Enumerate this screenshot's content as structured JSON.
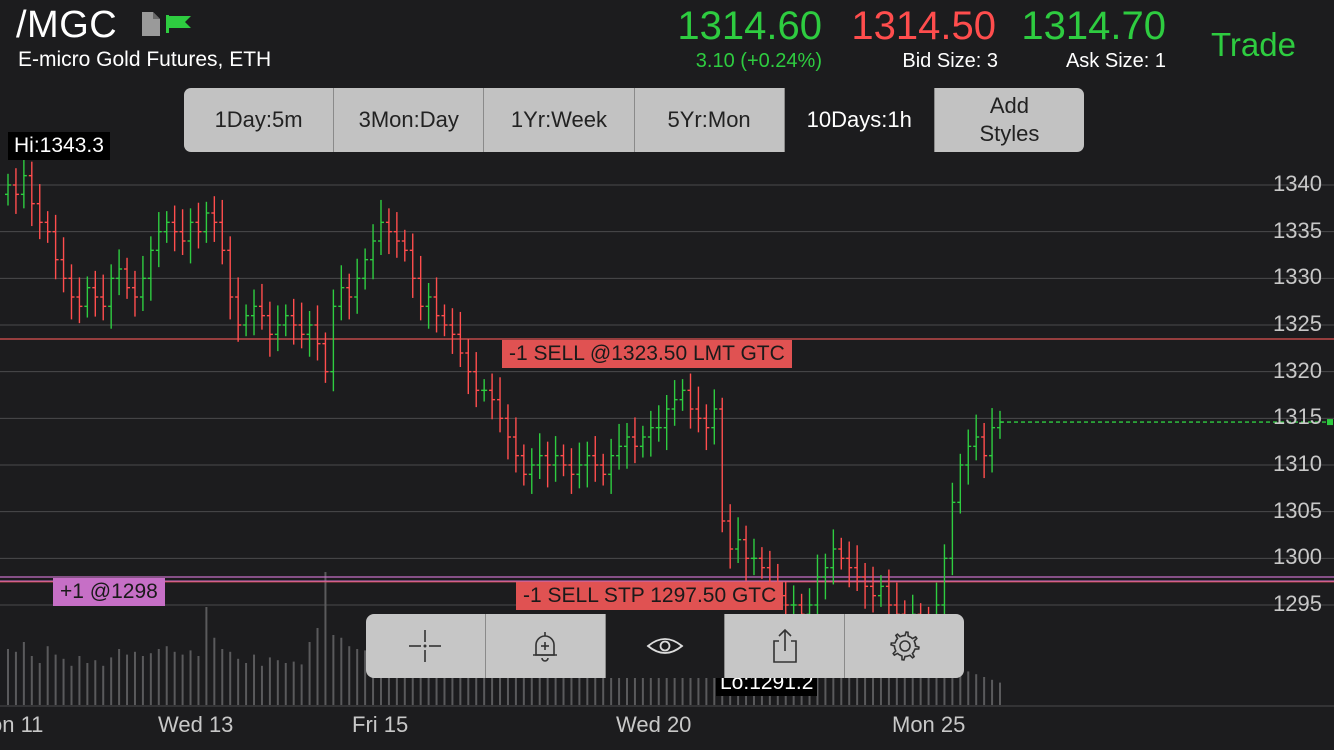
{
  "header": {
    "symbol": "/MGC",
    "subtitle": "E-micro Gold Futures, ETH",
    "last": "1314.60",
    "change": "3.10 (+0.24%)",
    "bid": "1314.50",
    "bid_size": "Bid Size: 3",
    "ask": "1314.70",
    "ask_size": "Ask Size: 1",
    "trade_label": "Trade",
    "colors": {
      "up": "#2ecc40",
      "down": "#ff4d4d"
    }
  },
  "ranges": [
    {
      "label": "1Day:5m"
    },
    {
      "label": "3Mon:Day"
    },
    {
      "label": "1Yr:Week"
    },
    {
      "label": "5Yr:Mon"
    },
    {
      "label": "10Days:1h",
      "active": true
    },
    {
      "label": "Add\nStyles"
    }
  ],
  "hi_label": "Hi:1343.3",
  "lo_label": "Lo:1291.2",
  "orders": {
    "sell_limit": "-1 SELL @1323.50 LMT GTC",
    "sell_stop": "-1 SELL STP 1297.50 GTC",
    "position": "+1 @1298"
  },
  "tools": [
    {
      "icon": "crosshair-icon"
    },
    {
      "icon": "alert-bell-icon"
    },
    {
      "icon": "eye-icon",
      "active": true
    },
    {
      "icon": "share-icon"
    },
    {
      "icon": "gear-icon"
    }
  ],
  "chart_data": {
    "type": "candlestick",
    "y_ticks": [
      "1340",
      "1335",
      "1330",
      "1325",
      "1320",
      "1315",
      "1310",
      "1305",
      "1300",
      "1295"
    ],
    "x_ticks": [
      "on 11",
      "Wed 13",
      "Fri 15",
      "Wed 20",
      "Mon 25"
    ],
    "ylim": [
      1288,
      1345
    ],
    "reference_lines": [
      {
        "label": "sell_limit",
        "value": 1323.5,
        "color": "#e05252"
      },
      {
        "label": "sell_stop",
        "value": 1297.5,
        "color": "#e05252"
      },
      {
        "label": "position",
        "value": 1298,
        "color": "#c66fc6"
      },
      {
        "label": "last",
        "value": 1314.6,
        "color": "#2ecc40",
        "dashed": true
      }
    ],
    "closes": [
      1340,
      1339,
      1341,
      1338,
      1336,
      1335,
      1332,
      1330,
      1328,
      1327,
      1329,
      1328,
      1327,
      1330,
      1331,
      1329,
      1328,
      1330,
      1333,
      1335,
      1336,
      1335,
      1334,
      1336,
      1335,
      1337,
      1336,
      1333,
      1328,
      1325,
      1326,
      1327,
      1326,
      1324,
      1325,
      1326,
      1325,
      1324,
      1325,
      1323,
      1320,
      1327,
      1329,
      1328,
      1330,
      1332,
      1334,
      1336,
      1335,
      1334,
      1333,
      1330,
      1327,
      1328,
      1326,
      1325,
      1324,
      1322,
      1320,
      1318,
      1318,
      1317,
      1315,
      1313,
      1311,
      1309,
      1310,
      1311,
      1310,
      1311,
      1310,
      1309,
      1310,
      1311,
      1310,
      1309,
      1311,
      1312,
      1313,
      1312,
      1313,
      1314,
      1314,
      1316,
      1317,
      1318,
      1316,
      1315,
      1314,
      1316,
      1304,
      1301,
      1302,
      1300,
      1300,
      1299,
      1297,
      1296,
      1295,
      1295,
      1294,
      1295,
      1298,
      1299,
      1301,
      1300,
      1299,
      1298,
      1297,
      1296,
      1297,
      1295,
      1294,
      1293,
      1294,
      1293,
      1292,
      1295,
      1300,
      1306,
      1310,
      1312,
      1313,
      1311,
      1314,
      1314.6
    ],
    "volumes": [
      40,
      38,
      45,
      35,
      30,
      42,
      36,
      33,
      28,
      35,
      30,
      32,
      28,
      34,
      40,
      36,
      38,
      35,
      37,
      40,
      42,
      38,
      36,
      39,
      35,
      70,
      48,
      40,
      38,
      33,
      30,
      36,
      28,
      34,
      32,
      30,
      31,
      29,
      45,
      55,
      95,
      50,
      48,
      42,
      40,
      39,
      44,
      46,
      40,
      37,
      35,
      33,
      32,
      30,
      28,
      34,
      31,
      30,
      29,
      27,
      33,
      30,
      28,
      31,
      29,
      30,
      27,
      28,
      29,
      30,
      31,
      28,
      27,
      26,
      25,
      28,
      27,
      29,
      30,
      28,
      26,
      27,
      25,
      28,
      29,
      27,
      26,
      25,
      28,
      24,
      40,
      36,
      34,
      32,
      30,
      28,
      29,
      27,
      26,
      25,
      24,
      26,
      27,
      25,
      26,
      28,
      27,
      25,
      24,
      26,
      25,
      24,
      23,
      25,
      26,
      24,
      22,
      26,
      30,
      28,
      26,
      24,
      22,
      20,
      18,
      16
    ]
  }
}
